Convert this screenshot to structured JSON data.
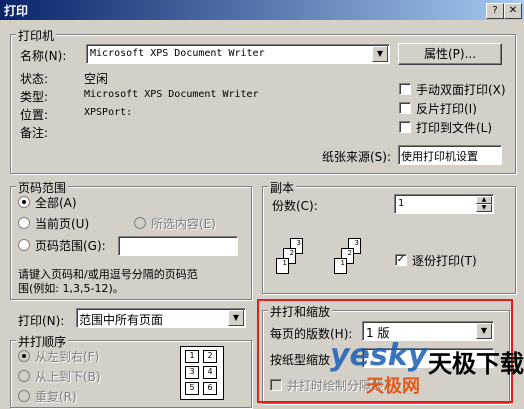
{
  "window": {
    "title": "打印"
  },
  "printer": {
    "group_label": "打印机",
    "name_label": "名称(N):",
    "name_value": "Microsoft XPS Document Writer",
    "properties_button": "属性(P)...",
    "status_label": "状态:",
    "status_value": "空闲",
    "type_label": "类型:",
    "type_value": "Microsoft XPS Document Writer",
    "where_label": "位置:",
    "where_value": "XPSPort:",
    "comment_label": "备注:",
    "manual_duplex": "手动双面打印(X)",
    "reverse_print": "反片打印(I)",
    "print_to_file": "打印到文件(L)",
    "paper_source_label": "纸张来源(S):",
    "paper_source_value": "使用打印机设置"
  },
  "page_range": {
    "group_label": "页码范围",
    "all": "全部(A)",
    "current": "当前页(U)",
    "selection": "所选内容(E)",
    "pages": "页码范围(G):",
    "hint_line1": "请键入页码和/或用逗号分隔的页码范",
    "hint_line2": "围(例如: 1,3,5-12)。"
  },
  "print_what": {
    "label": "打印(N):",
    "value": "范围中所有页面"
  },
  "print_order": {
    "group_label": "并打顺序",
    "left_to_right": "从左到右(F)",
    "top_to_bottom": "从上到下(B)",
    "repeat": "重复(R)",
    "grid": [
      "1",
      "2",
      "3",
      "4",
      "5",
      "6"
    ]
  },
  "copies": {
    "group_label": "副本",
    "count_label": "份数(C):",
    "count_value": "1",
    "collate": "逐份打印(T)",
    "page_nums": [
      "1",
      "2",
      "3"
    ]
  },
  "zoom": {
    "group_label": "并打和缩放",
    "pages_per_sheet_label": "每页的版数(H):",
    "pages_per_sheet_value": "1 版",
    "scale_label": "按纸型缩放",
    "draw_borders": "并打时绘制分隔线"
  },
  "watermark": {
    "brand": "yesky",
    "cn1": "天极下载",
    "cn2": "天极网"
  }
}
